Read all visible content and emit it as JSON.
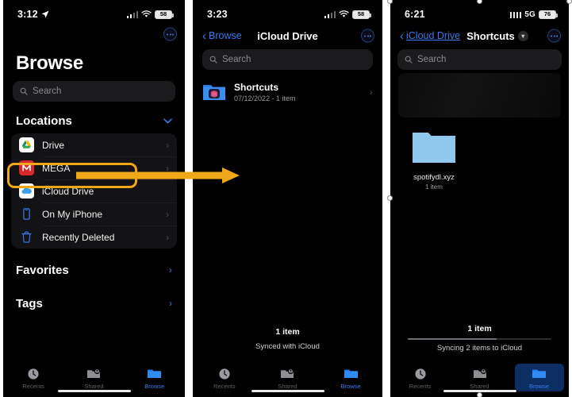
{
  "panels": [
    {
      "status": {
        "time": "3:12",
        "location_icon": "location-arrow-icon",
        "signal": "signal-bars-icon",
        "wifi": "wifi-icon",
        "network": "",
        "battery": "58"
      },
      "nav": {
        "more_button": "more-options-icon"
      },
      "title": "Browse",
      "search": {
        "placeholder": "Search",
        "icon": "search-icon"
      },
      "sections": {
        "locations_label": "Locations",
        "locations_chevron": "chevron-down-icon",
        "locations": [
          {
            "label": "Drive",
            "icon": "google-drive-icon",
            "chevron": "›"
          },
          {
            "label": "MEGA",
            "icon": "mega-icon",
            "chevron": "›"
          },
          {
            "label": "iCloud Drive",
            "icon": "icloud-icon",
            "chevron": "›",
            "highlighted": true
          },
          {
            "label": "On My iPhone",
            "icon": "iphone-icon",
            "chevron": "›"
          },
          {
            "label": "Recently Deleted",
            "icon": "trash-icon",
            "chevron": "›"
          }
        ],
        "favorites_label": "Favorites",
        "favorites_chevron": "›",
        "tags_label": "Tags",
        "tags_chevron": "›"
      },
      "tabs": [
        {
          "label": "Recents",
          "icon": "clock-icon",
          "active": false
        },
        {
          "label": "Shared",
          "icon": "shared-folder-icon",
          "active": false
        },
        {
          "label": "Browse",
          "icon": "folder-icon",
          "active": true
        }
      ]
    },
    {
      "status": {
        "time": "3:23",
        "location_icon": "",
        "signal": "signal-bars-icon",
        "wifi": "wifi-icon",
        "network": "",
        "battery": "58"
      },
      "nav": {
        "back_label": "Browse",
        "back_chevron": "chevron-left-icon",
        "title": "iCloud Drive",
        "more_button": "more-options-icon"
      },
      "search": {
        "placeholder": "Search",
        "icon": "search-icon"
      },
      "files": [
        {
          "name": "Shortcuts",
          "subtitle": "07/12/2022 - 1 item",
          "icon": "shortcuts-folder-icon",
          "chevron": "›"
        }
      ],
      "footer": {
        "count": "1 item",
        "status": "Synced with iCloud"
      },
      "tabs": [
        {
          "label": "Recents",
          "icon": "clock-icon",
          "active": false
        },
        {
          "label": "Shared",
          "icon": "shared-folder-icon",
          "active": false
        },
        {
          "label": "Browse",
          "icon": "folder-icon",
          "active": true
        }
      ]
    },
    {
      "status": {
        "time": "6:21",
        "location_icon": "",
        "signal": "signal-dots-icon",
        "wifi": "",
        "network": "5G",
        "battery": "76"
      },
      "nav": {
        "back_label": "iCloud Drive",
        "back_chevron": "chevron-left-icon",
        "title": "Shortcuts",
        "title_chevron": "chevron-down-icon",
        "more_button": "more-options-icon"
      },
      "search": {
        "placeholder": "Search",
        "icon": "search-icon"
      },
      "grid": [
        {
          "name": "spotifydl.xyz",
          "subtitle": "1 item",
          "icon": "folder-icon"
        }
      ],
      "footer": {
        "count": "1 item",
        "status": "Syncing 2 items to iCloud"
      },
      "tabs": [
        {
          "label": "Recents",
          "icon": "clock-icon",
          "active": false
        },
        {
          "label": "Shared",
          "icon": "shared-folder-icon",
          "active": false
        },
        {
          "label": "Browse",
          "icon": "folder-icon",
          "active": true
        }
      ]
    }
  ],
  "annotation": {
    "arrow_color": "#f0a818",
    "highlight_color": "#f0a818",
    "arrow_name": "step-arrow"
  }
}
